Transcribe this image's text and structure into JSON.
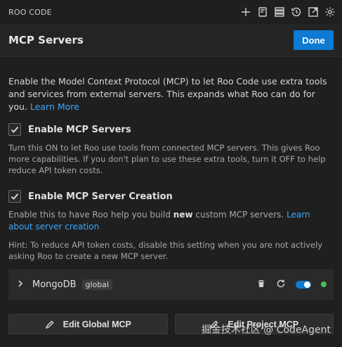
{
  "app": {
    "title": "ROO CODE"
  },
  "toolbar": {
    "icons": [
      "plus-icon",
      "history-panel-icon",
      "server-stack-icon",
      "history-icon",
      "popout-icon",
      "gear-icon"
    ]
  },
  "header": {
    "title": "MCP Servers",
    "done_label": "Done"
  },
  "intro": {
    "text": "Enable the Model Context Protocol (MCP) to let Roo Code use extra tools and services from external servers. This expands what Roo can do for you.",
    "link": "Learn More"
  },
  "enable_servers": {
    "checked": true,
    "label": "Enable MCP Servers",
    "description": "Turn this ON to let Roo use tools from connected MCP servers. This gives Roo more capabilities. If you don't plan to use these extra tools, turn it OFF to help reduce API token costs."
  },
  "enable_creation": {
    "checked": true,
    "label": "Enable MCP Server Creation",
    "desc_pre": "Enable this to have Roo help you build",
    "desc_bold": "new",
    "desc_post": "custom MCP servers.",
    "link": "Learn about server creation",
    "hint": "Hint: To reduce API token costs, disable this setting when you are not actively asking Roo to create a new MCP server."
  },
  "servers": [
    {
      "name": "MongoDB",
      "scope": "global",
      "enabled": true,
      "status_color": "#4ac05a"
    }
  ],
  "buttons": {
    "edit_global": "Edit Global MCP",
    "edit_project": "Edit Project MCP"
  },
  "watermark": "掘金技术社区 @ CodeAgent",
  "colors": {
    "accent": "#0e7ad1",
    "link": "#3ea6f5",
    "status_ok": "#4ac05a"
  }
}
